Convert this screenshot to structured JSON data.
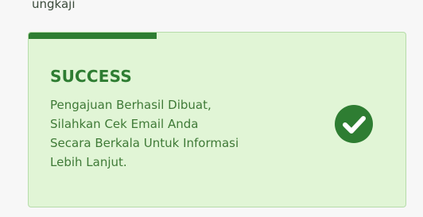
{
  "page_top_text": "ungkaji",
  "toast": {
    "type": "success",
    "title": "SUCCESS",
    "message_lines": [
      "Pengajuan Berhasil Dibuat,",
      "Silahkan Cek Email Anda",
      "Secara Berkala Untuk Informasi",
      "Lebih Lanjut."
    ],
    "progress_fraction": 0.34,
    "icon": "check-circle-icon",
    "colors": {
      "accent": "#2e7d32",
      "background": "#e1f5d6",
      "border": "#b6dcaa",
      "text": "#3f7a37"
    }
  }
}
